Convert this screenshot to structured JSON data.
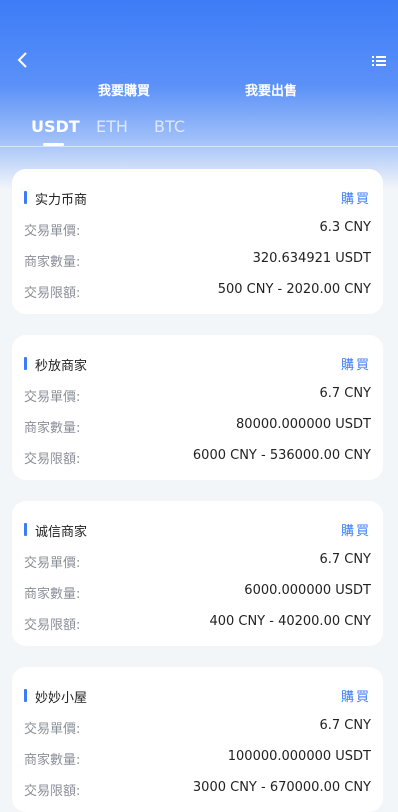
{
  "header": {
    "trade_tabs": [
      "我要購買",
      "我要出售"
    ],
    "coin_tabs": [
      "USDT",
      "ETH",
      "BTC"
    ],
    "active_coin": "USDT"
  },
  "labels": {
    "price": "交易單價:",
    "quantity": "商家數量:",
    "limit": "交易限額:"
  },
  "merchants": [
    {
      "name": "实力币商",
      "action": "購買",
      "price": "6.3 CNY",
      "quantity": "320.634921 USDT",
      "limit": "500 CNY - 2020.00 CNY"
    },
    {
      "name": "秒放商家",
      "action": "購買",
      "price": "6.7 CNY",
      "quantity": "80000.000000 USDT",
      "limit": "6000 CNY - 536000.00 CNY"
    },
    {
      "name": "诚信商家",
      "action": "購買",
      "price": "6.7 CNY",
      "quantity": "6000.000000 USDT",
      "limit": "400 CNY - 40200.00 CNY"
    },
    {
      "name": "妙妙小屋",
      "action": "購買",
      "price": "6.7 CNY",
      "quantity": "100000.000000 USDT",
      "limit": "3000 CNY - 670000.00 CNY"
    }
  ],
  "colors": {
    "accent": "#3d7cf7"
  }
}
